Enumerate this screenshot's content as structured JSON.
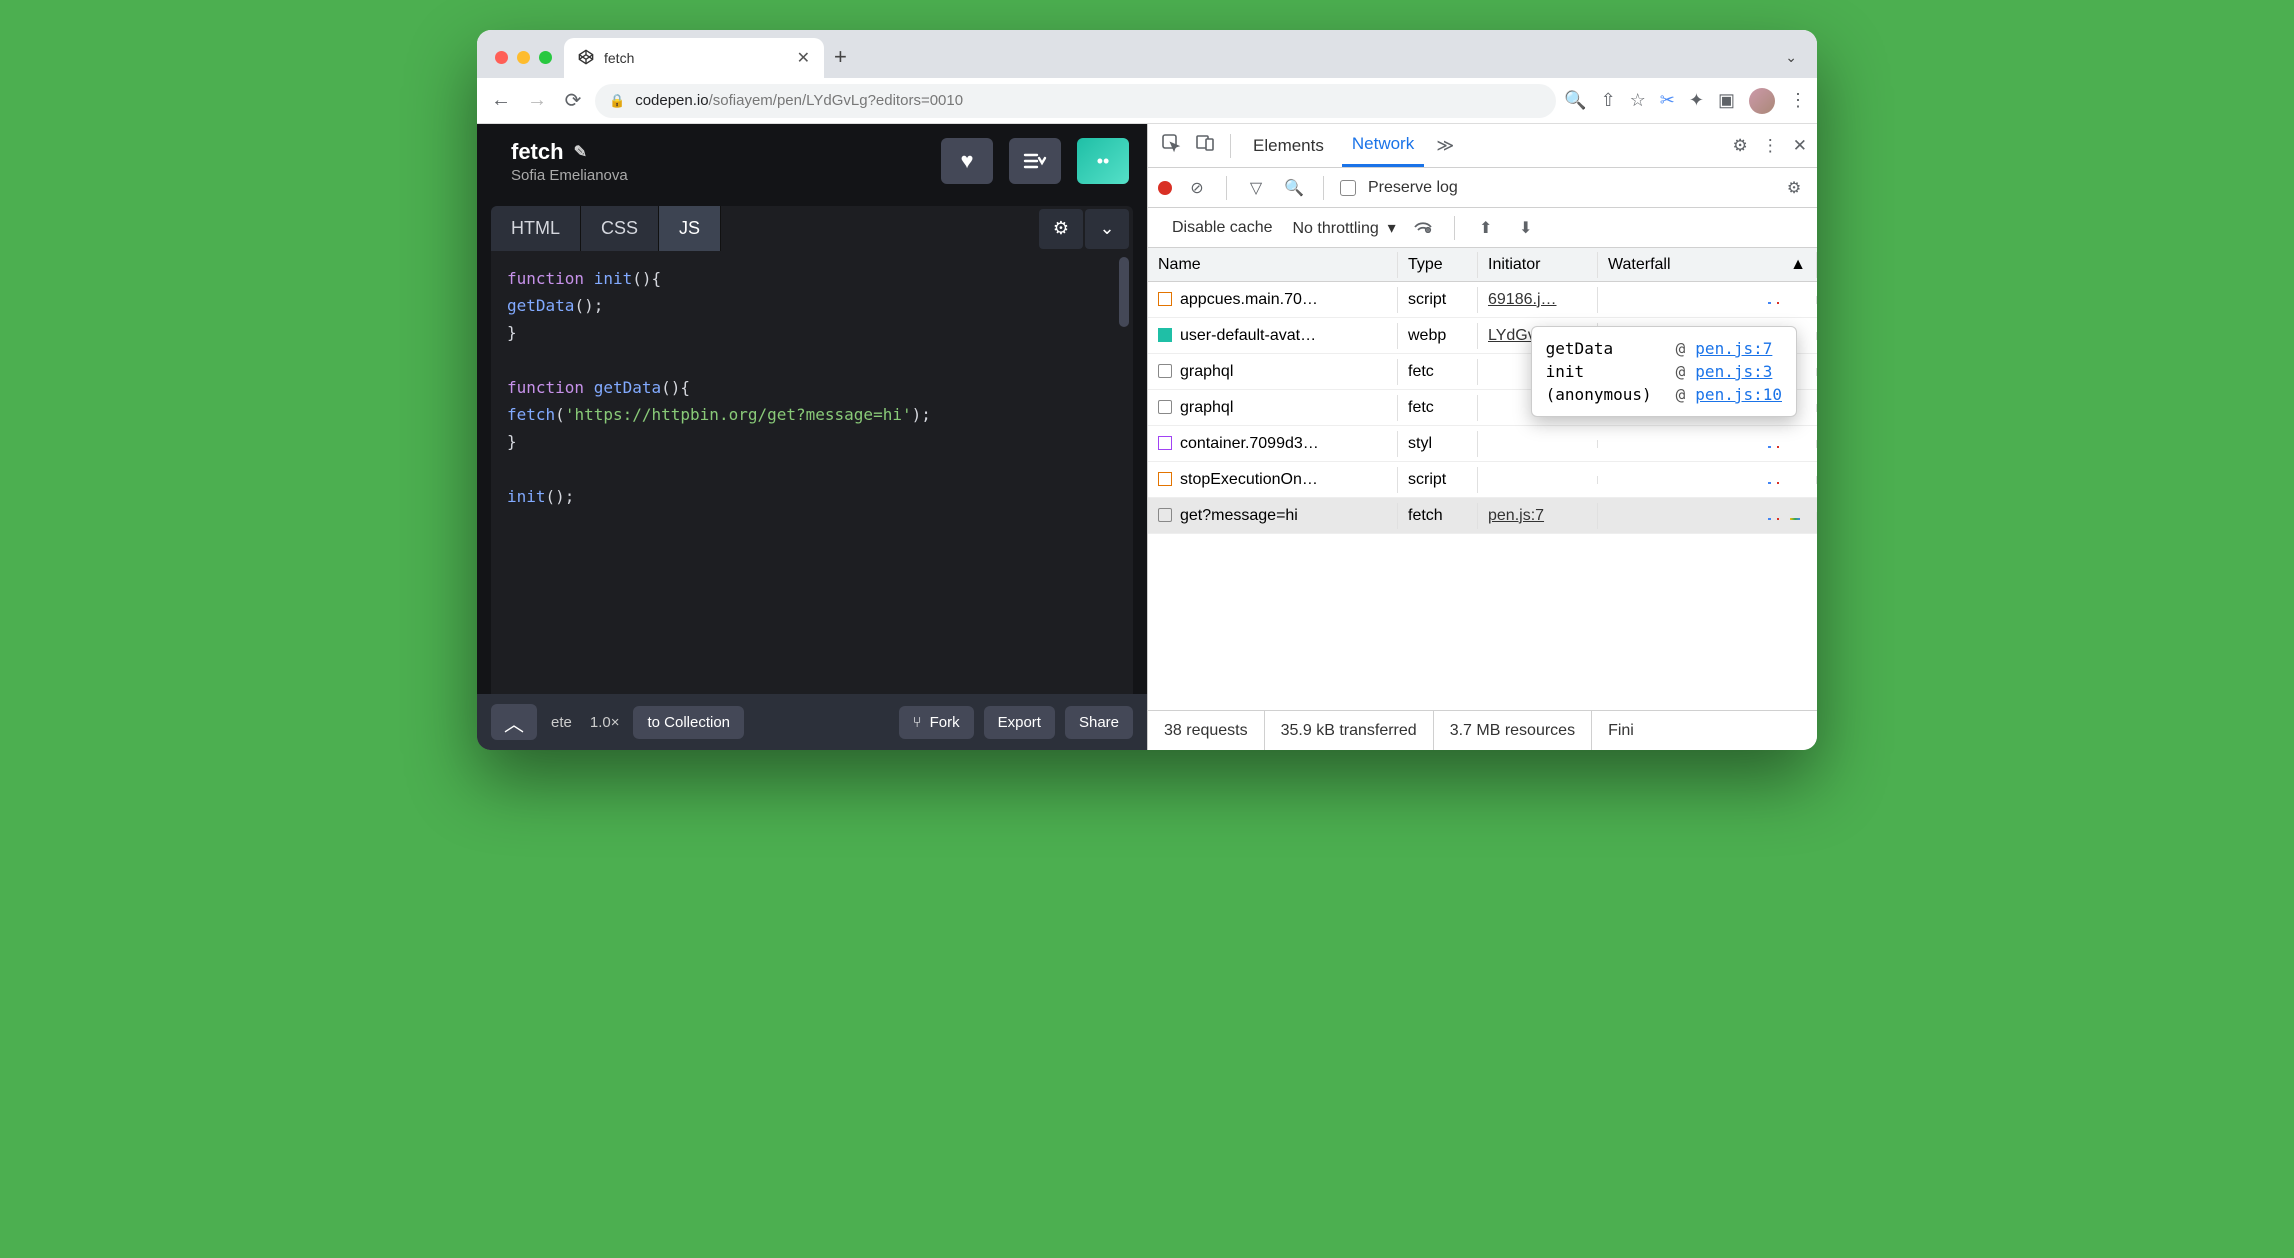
{
  "browser": {
    "tab_title": "fetch",
    "url_host": "codepen.io",
    "url_path": "/sofiayem/pen/LYdGvLg?editors=0010"
  },
  "codepen": {
    "title": "fetch",
    "author": "Sofia Emelianova",
    "tabs": {
      "html": "HTML",
      "css": "CSS",
      "js": "JS"
    },
    "code_lines": [
      [
        [
          "kw",
          "function "
        ],
        [
          "fn",
          "init"
        ],
        [
          "plain",
          "(){"
        ]
      ],
      [
        [
          "plain",
          "  "
        ],
        [
          "fn",
          "getData"
        ],
        [
          "plain",
          "();"
        ]
      ],
      [
        [
          "plain",
          "}"
        ]
      ],
      [
        [
          "plain",
          ""
        ]
      ],
      [
        [
          "kw",
          "function "
        ],
        [
          "fn",
          "getData"
        ],
        [
          "plain",
          "(){"
        ]
      ],
      [
        [
          "plain",
          "  "
        ],
        [
          "fn",
          "fetch"
        ],
        [
          "plain",
          "("
        ],
        [
          "str",
          "'https://httpbin.org/get?message=hi'"
        ],
        [
          "plain",
          ");"
        ]
      ],
      [
        [
          "plain",
          "}"
        ]
      ],
      [
        [
          "plain",
          ""
        ]
      ],
      [
        [
          "fn",
          "init"
        ],
        [
          "plain",
          "();"
        ]
      ]
    ],
    "footer": {
      "zoom_prefix": "ete",
      "zoom": "1.0×",
      "to_collection": "to Collection",
      "fork": "Fork",
      "export": "Export",
      "share": "Share"
    }
  },
  "devtools": {
    "tabs": {
      "elements": "Elements",
      "network": "Network"
    },
    "preserve_log": "Preserve log",
    "disable_cache": "Disable cache",
    "throttling": "No throttling",
    "columns": {
      "name": "Name",
      "type": "Type",
      "initiator": "Initiator",
      "waterfall": "Waterfall"
    },
    "rows": [
      {
        "icon": "js",
        "name": "appcues.main.70…",
        "type": "script",
        "initiator": "69186.j…"
      },
      {
        "icon": "wp",
        "name": "user-default-avat…",
        "type": "webp",
        "initiator": "LYdGvL…"
      },
      {
        "icon": "chk",
        "name": "graphql",
        "type": "fetc",
        "initiator": ""
      },
      {
        "icon": "chk",
        "name": "graphql",
        "type": "fetc",
        "initiator": ""
      },
      {
        "icon": "st",
        "name": "container.7099d3…",
        "type": "styl",
        "initiator": ""
      },
      {
        "icon": "js",
        "name": "stopExecutionOn…",
        "type": "script",
        "initiator": ""
      },
      {
        "icon": "chk",
        "name": "get?message=hi",
        "type": "fetch",
        "initiator": "pen.js:7",
        "selected": true
      }
    ],
    "tooltip": [
      {
        "fn": "getData",
        "loc": "pen.js:7"
      },
      {
        "fn": "init",
        "loc": "pen.js:3"
      },
      {
        "fn": "(anonymous)",
        "loc": "pen.js:10"
      }
    ],
    "status": {
      "requests": "38 requests",
      "transferred": "35.9 kB transferred",
      "resources": "3.7 MB resources",
      "finish": "Fini"
    }
  }
}
